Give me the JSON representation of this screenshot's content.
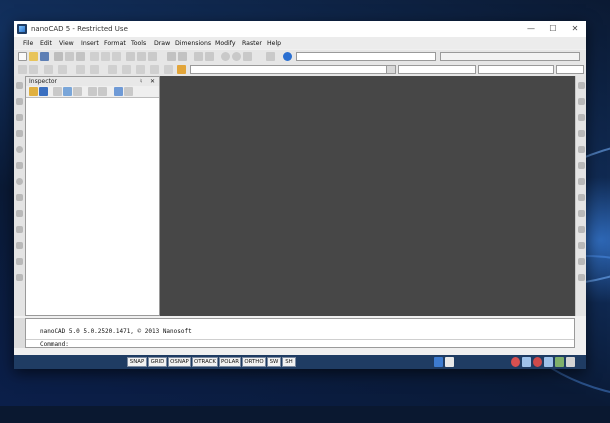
{
  "window": {
    "title": "nanoCAD 5 - Restricted Use",
    "controls": {
      "minimize": "—",
      "maximize": "☐",
      "close": "✕"
    }
  },
  "menu": [
    "File",
    "Edit",
    "View",
    "Insert",
    "Format",
    "Tools",
    "Draw",
    "Dimensions",
    "Modify",
    "Raster",
    "Help"
  ],
  "inspector": {
    "title": "Inspector",
    "pin": "♮",
    "close": "✕"
  },
  "command": {
    "history": "nanoCAD 5.0 5.0.2520.1471, © 2013 Nanosoft",
    "prompt": "Command:"
  },
  "status_toggles": [
    "SNAP",
    "GRID",
    "OSNAP",
    "OTRACK",
    "POLAR",
    "ORTHO",
    "SW",
    "SH"
  ],
  "colors": {
    "canvas": "#474747",
    "statusbar": "#1f3c63",
    "chrome": "#f0f0f0"
  },
  "icons": [
    "new-icon",
    "open-icon",
    "save-icon",
    "print-icon",
    "undo-icon",
    "redo-icon",
    "zoom-icon",
    "help-icon"
  ]
}
